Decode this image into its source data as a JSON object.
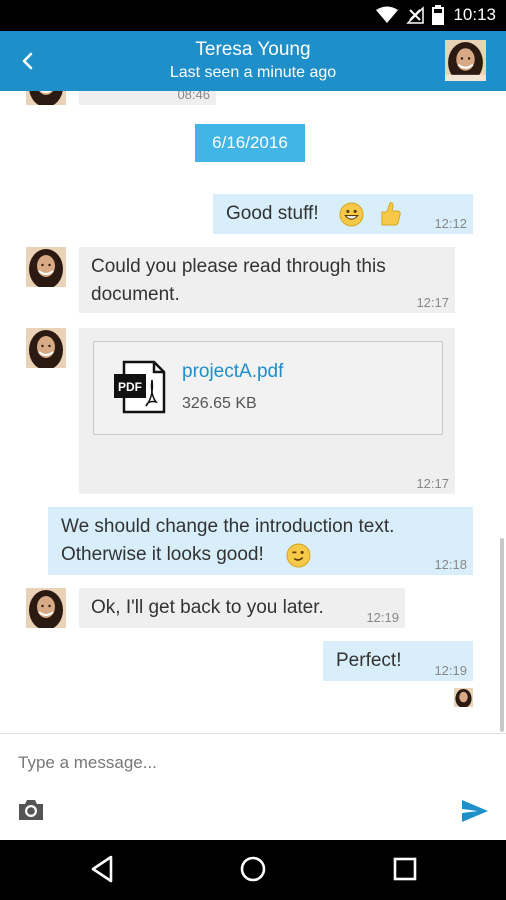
{
  "status_bar": {
    "time": "10:13"
  },
  "header": {
    "title": "Teresa Young",
    "subtitle": "Last seen a minute ago",
    "partial_top_time": "08:46"
  },
  "chat": {
    "date_divider": "6/16/2016",
    "messages": [
      {
        "dir": "out",
        "text": "Good stuff!",
        "time": "12:12"
      },
      {
        "dir": "in",
        "text_line1": "Could you please read through this",
        "text_line2": "document.",
        "time": "12:17"
      },
      {
        "dir": "in",
        "file_name": "projectA.pdf",
        "file_size": "326.65 KB",
        "file_icon_label": "PDF",
        "time": "12:17"
      },
      {
        "dir": "out",
        "text_line1": "We should change the introduction text.",
        "text_line2": "Otherwise it looks good!",
        "time": "12:18"
      },
      {
        "dir": "in",
        "text": "Ok, I'll get back to you later.",
        "time": "12:19"
      },
      {
        "dir": "out",
        "text": "Perfect!",
        "time": "12:19"
      }
    ]
  },
  "composer": {
    "placeholder": "Type a message..."
  },
  "colors": {
    "app_bar": "#1e8fc9",
    "date_pill": "#41b5e6",
    "incoming_bubble": "#efefef",
    "outgoing_bubble": "#d8eefb"
  },
  "icons": [
    "back-arrow-icon",
    "wifi-icon",
    "no-signal-icon",
    "battery-icon",
    "pdf-file-icon",
    "grinning-emoji-icon",
    "thumbs-up-emoji-icon",
    "winking-emoji-icon",
    "camera-icon",
    "send-icon",
    "nav-back-icon",
    "nav-home-icon",
    "nav-recents-icon"
  ]
}
